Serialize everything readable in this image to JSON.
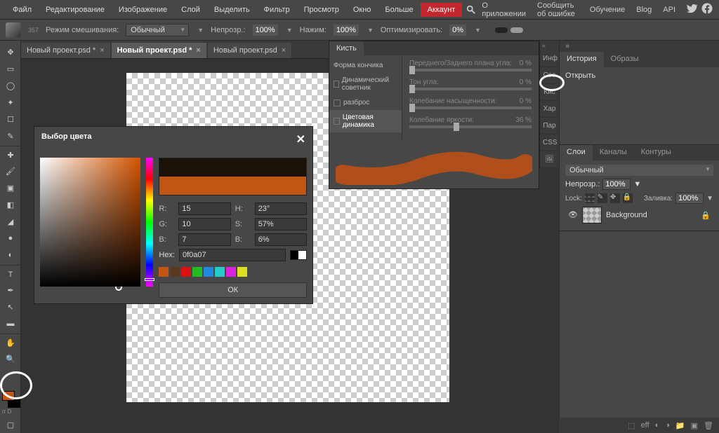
{
  "menu": {
    "items": [
      "Файл",
      "Редактирование",
      "Изображение",
      "Слой",
      "Выделить",
      "Фильтр",
      "Просмотр",
      "Окно",
      "Больше"
    ],
    "account": "Аккаунт",
    "right": [
      "О приложении",
      "Сообщить об ошибке",
      "Обучение",
      "Blog",
      "API"
    ]
  },
  "optbar": {
    "brushNum": "357",
    "blendModeLabel": "Режим смешивания:",
    "blendMode": "Обычный",
    "opacityLabel": "Непрозр.:",
    "opacity": "100%",
    "flowLabel": "Нажим:",
    "flow": "100%",
    "smoothLabel": "Оптимизировать:",
    "smooth": "0%"
  },
  "tabs": [
    {
      "title": "Новый проект.psd *",
      "active": false
    },
    {
      "title": "Новый проект.psd *",
      "active": true
    },
    {
      "title": "Новый проект.psd",
      "active": false
    }
  ],
  "miniTabs": [
    "Инф",
    "Сво",
    "Кис",
    "Хар",
    "Пар",
    "CSS"
  ],
  "historyPanel": {
    "tabs": [
      "История",
      "Образы"
    ],
    "item": "Открыть"
  },
  "layersPanel": {
    "tabs": [
      "Слои",
      "Каналы",
      "Контуры"
    ],
    "blendMode": "Обычный",
    "opacityLabel": "Непрозр.:",
    "opacity": "100%",
    "lockLabel": "Lock:",
    "fillLabel": "Заливка:",
    "fill": "100%",
    "layerName": "Background"
  },
  "statusbar": {
    "eff": "eff"
  },
  "colorPicker": {
    "title": "Выбор цвета",
    "R": "15",
    "G": "10",
    "B": "7",
    "H": "23°",
    "S": "57%",
    "Bv": "6%",
    "hexLabel": "Hex:",
    "hex": "0f0a07",
    "ok": "ОК",
    "newColor": "#c15614",
    "swatches": [
      "#c15614",
      "#5a3a1e",
      "#d11",
      "#2b2",
      "#28d",
      "#2cc",
      "#d2d",
      "#dd2"
    ]
  },
  "brushPanel": {
    "tab": "Кисть",
    "items": [
      "Форма кончика",
      "Динамический советник",
      "разброс",
      "Цветовая динамика"
    ],
    "sliders": [
      {
        "label": "Переднего/Заднего плана угла:",
        "value": "0 %",
        "pos": 0
      },
      {
        "label": "Тон угла:",
        "value": "0 %",
        "pos": 0
      },
      {
        "label": "Колебание насыщенности:",
        "value": "0 %",
        "pos": 0
      },
      {
        "label": "Колебание яркости:",
        "value": "36 %",
        "pos": 36
      }
    ],
    "strokeColor": "#b04f1b"
  },
  "swatch": {
    "fg": "#c15614",
    "bgLabel": "іт D"
  }
}
